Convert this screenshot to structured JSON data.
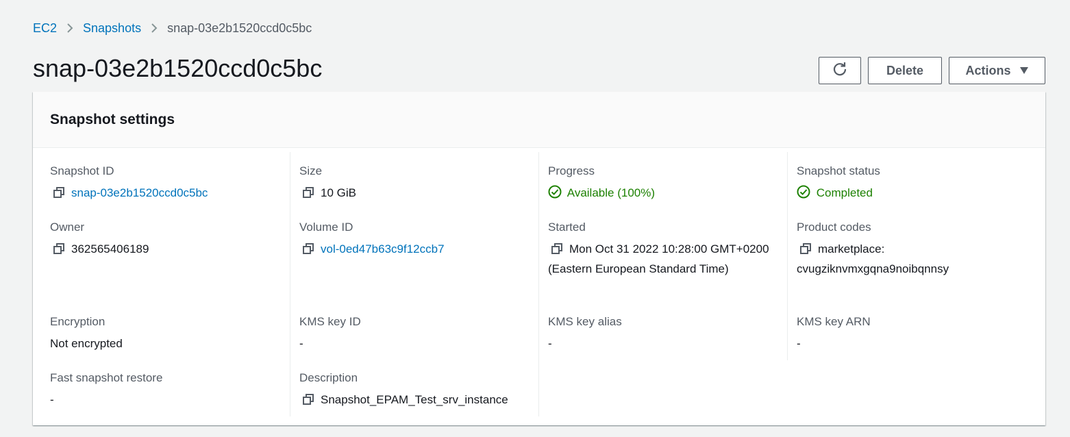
{
  "breadcrumb": {
    "items": [
      "EC2",
      "Snapshots"
    ],
    "current": "snap-03e2b1520ccd0c5bc"
  },
  "page": {
    "title": "snap-03e2b1520ccd0c5bc"
  },
  "actions": {
    "delete_label": "Delete",
    "actions_label": "Actions"
  },
  "panel": {
    "title": "Snapshot settings",
    "fields": {
      "snapshot_id": {
        "label": "Snapshot ID",
        "value": "snap-03e2b1520ccd0c5bc"
      },
      "owner": {
        "label": "Owner",
        "value": "362565406189"
      },
      "encryption": {
        "label": "Encryption",
        "value": "Not encrypted"
      },
      "fast_restore": {
        "label": "Fast snapshot restore",
        "value": "-"
      },
      "size": {
        "label": "Size",
        "value": "10 GiB"
      },
      "volume_id": {
        "label": "Volume ID",
        "value": "vol-0ed47b63c9f12ccb7"
      },
      "kms_key_id": {
        "label": "KMS key ID",
        "value": "-"
      },
      "description": {
        "label": "Description",
        "value": "Snapshot_EPAM_Test_srv_instance"
      },
      "progress": {
        "label": "Progress",
        "value": "Available (100%)"
      },
      "started": {
        "label": "Started",
        "value": "Mon Oct 31 2022 10:28:00 GMT+0200 (Eastern European Standard Time)"
      },
      "kms_key_alias": {
        "label": "KMS key alias",
        "value": "-"
      },
      "snapshot_status": {
        "label": "Snapshot status",
        "value": "Completed"
      },
      "product_codes": {
        "label": "Product codes",
        "value": "marketplace: cvugziknvmxgqna9noibqnnsy"
      },
      "kms_key_arn": {
        "label": "KMS key ARN",
        "value": "-"
      }
    }
  },
  "colors": {
    "link": "#0073bb",
    "success": "#1d8102",
    "text": "#16191f",
    "label": "#545b64",
    "background": "#f2f3f3"
  }
}
